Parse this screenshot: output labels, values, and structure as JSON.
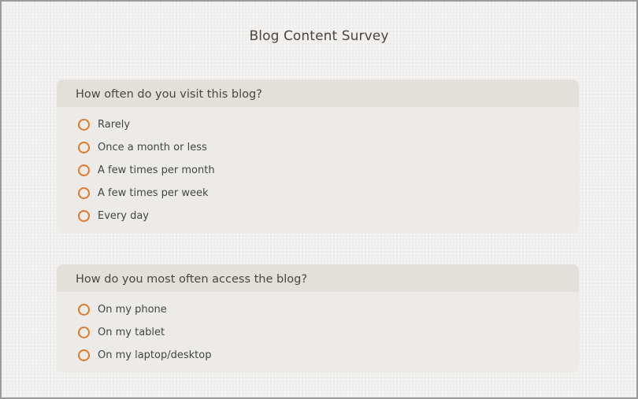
{
  "survey": {
    "title": "Blog Content Survey",
    "questions": [
      {
        "text": "How often do you visit this blog?",
        "options": [
          "Rarely",
          "Once a month or less",
          "A few times per month",
          "A few times per week",
          "Every day"
        ]
      },
      {
        "text": "How do you most often access the blog?",
        "options": [
          "On my phone",
          "On my tablet",
          "On my laptop/desktop"
        ]
      }
    ]
  },
  "colors": {
    "accent": "#e07a2c",
    "card_background": "#ecebe8",
    "card_header": "#e3e0db",
    "page_background": "#f2f1f0"
  }
}
